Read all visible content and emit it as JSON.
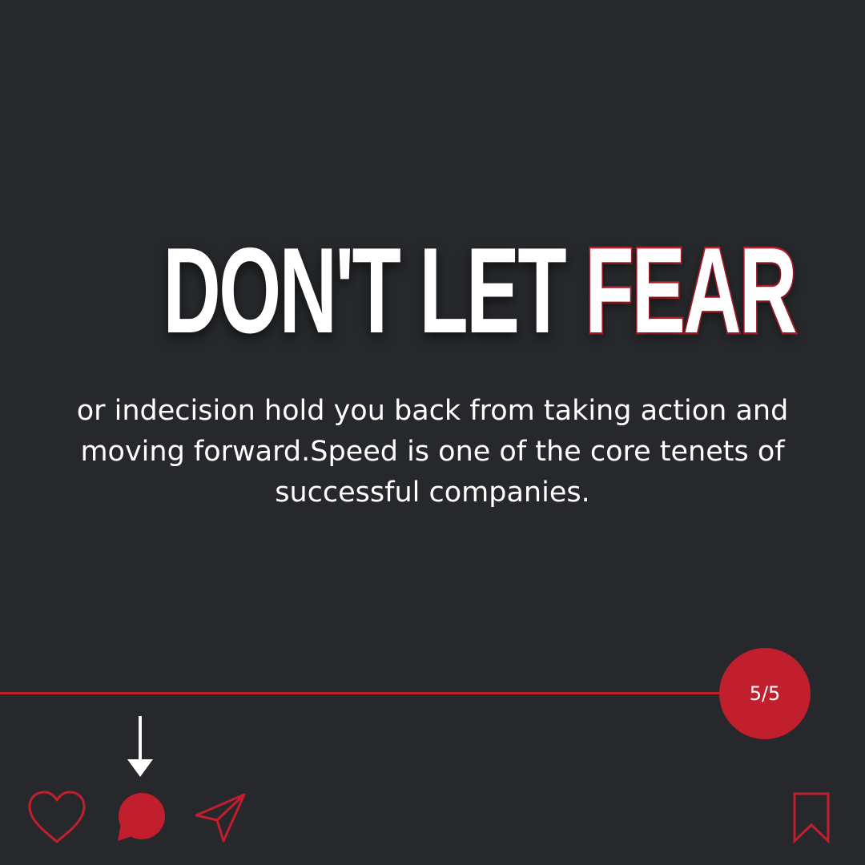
{
  "slide": {
    "headline": {
      "white_part": "DON'T LET",
      "accent_part": "FEAR"
    },
    "body": {
      "line1": "or indecision hold you back from taking action and",
      "line2": "moving forward.Speed is one of the core tenets of",
      "line3": "successful companies."
    },
    "pagination": {
      "label": "5/5"
    }
  },
  "icons": {
    "arrow": "arrow-down-icon",
    "like": "heart-icon",
    "comment": "comment-icon",
    "share": "send-icon",
    "save": "bookmark-icon"
  },
  "colors": {
    "background": "#26282b",
    "accent": "#c11f2e",
    "text": "#ffffff"
  }
}
